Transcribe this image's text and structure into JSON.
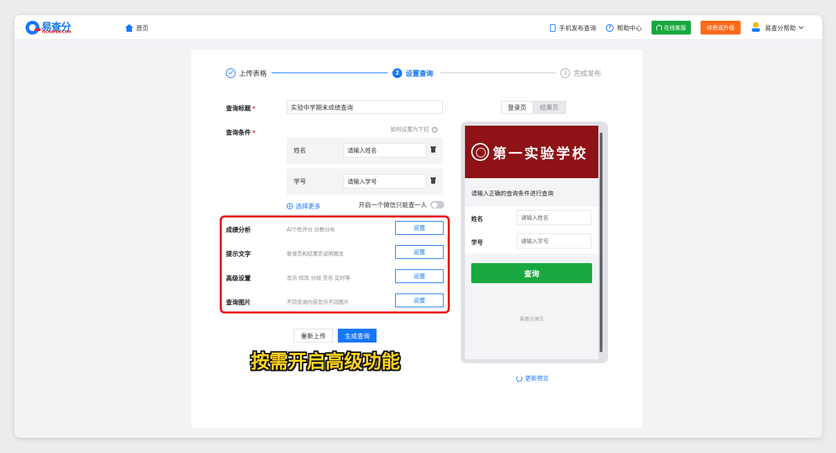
{
  "header": {
    "logo_text": "易查分",
    "logo_sub": "YICHAFEN.COM",
    "home_label": "首页",
    "mobile_publish": "手机发布查询",
    "help_center": "帮助中心",
    "online_support": "在线客服",
    "renew": "续费或升级",
    "user_menu": "易查分帮助"
  },
  "steps": [
    {
      "number": "1",
      "label": "上传表格"
    },
    {
      "number": "2",
      "label": "设置查询"
    },
    {
      "number": "3",
      "label": "完成发布"
    }
  ],
  "form": {
    "title_label": "查询标题",
    "title_value": "实验中学期末成绩查询",
    "conditions_label": "查询条件",
    "conditions_hint": "如何设置为下拉",
    "conditions": [
      {
        "name": "姓名",
        "placeholder": "请输入姓名"
      },
      {
        "name": "学号",
        "placeholder": "请输入学号"
      }
    ],
    "more_label": "选择更多",
    "wechat_toggle_label": "开启一个微信只能查一人",
    "options": [
      {
        "label": "成绩分析",
        "desc": "AI个性评分 分数分布",
        "button": "设置"
      },
      {
        "label": "提示文字",
        "desc": "登录页和结果页说明图文",
        "button": "设置"
      },
      {
        "label": "高级设置",
        "desc": "显示 修改 分组 签名 定时等",
        "button": "设置"
      },
      {
        "label": "查询图片",
        "desc": "不同查询内容显示不同图片",
        "button": "设置"
      }
    ],
    "reupload_label": "重新上传",
    "generate_label": "生成查询"
  },
  "overlay_caption": "按需开启高级功能",
  "preview": {
    "tabs": [
      "登录页",
      "结果页"
    ],
    "school_name": "第一实验学校",
    "prompt": "请输入正确的查询条件进行查询",
    "fields": [
      {
        "label": "姓名",
        "placeholder": "请输入姓名"
      },
      {
        "label": "学号",
        "placeholder": "请输入学号"
      }
    ],
    "query_button": "查询",
    "footer": "易查分演示",
    "refresh_label": "更新预览"
  },
  "colors": {
    "primary": "#1677ff",
    "green": "#19a83f",
    "orange": "#ff6a1a",
    "highlight_red": "#e8141c",
    "banner_red": "#8e1216",
    "caption_yellow": "#ffd21e"
  }
}
